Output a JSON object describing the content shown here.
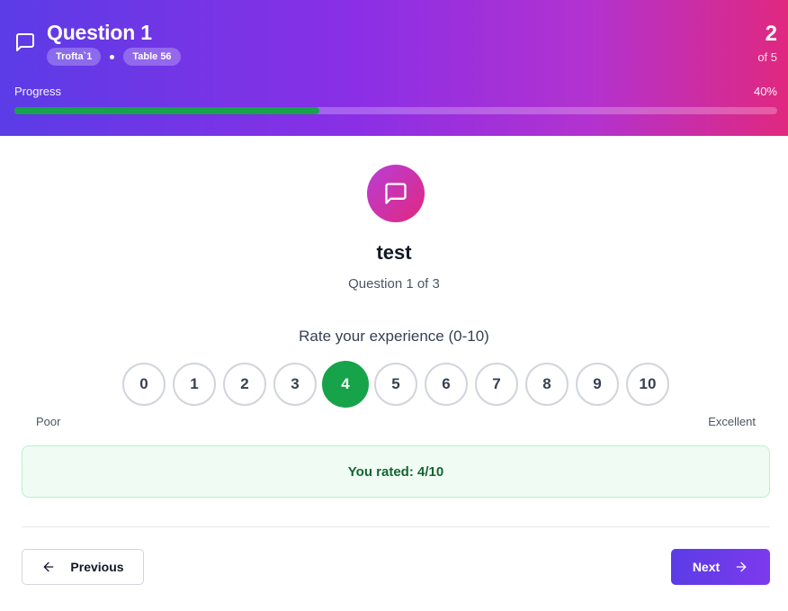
{
  "header": {
    "icon": "message-square-icon",
    "title": "Question 1",
    "chips": [
      "Trofta`1",
      "Table 56"
    ],
    "counter_current": "2",
    "counter_total": "of 5",
    "progress_label": "Progress",
    "progress_percent_text": "40%",
    "progress_value": 0.4
  },
  "question": {
    "icon": "message-square-icon",
    "title": "test",
    "subtitle": "Question 1 of 3",
    "prompt": "Rate your experience (0-10)"
  },
  "rating": {
    "options": [
      "0",
      "1",
      "2",
      "3",
      "4",
      "5",
      "6",
      "7",
      "8",
      "9",
      "10"
    ],
    "selected": "4",
    "low_label": "Poor",
    "high_label": "Excellent",
    "result_text": "You rated: 4/10"
  },
  "nav": {
    "prev_label": "Previous",
    "next_label": "Next",
    "prev_icon": "arrow-left-icon",
    "next_icon": "arrow-right-icon"
  },
  "colors": {
    "header_gradient_start": "#5b3ce6",
    "header_gradient_end": "#e0287f",
    "selected_green": "#16a34a",
    "result_bg": "#effbf3",
    "result_text": "#166534",
    "next_button": "#5b3ce6"
  }
}
